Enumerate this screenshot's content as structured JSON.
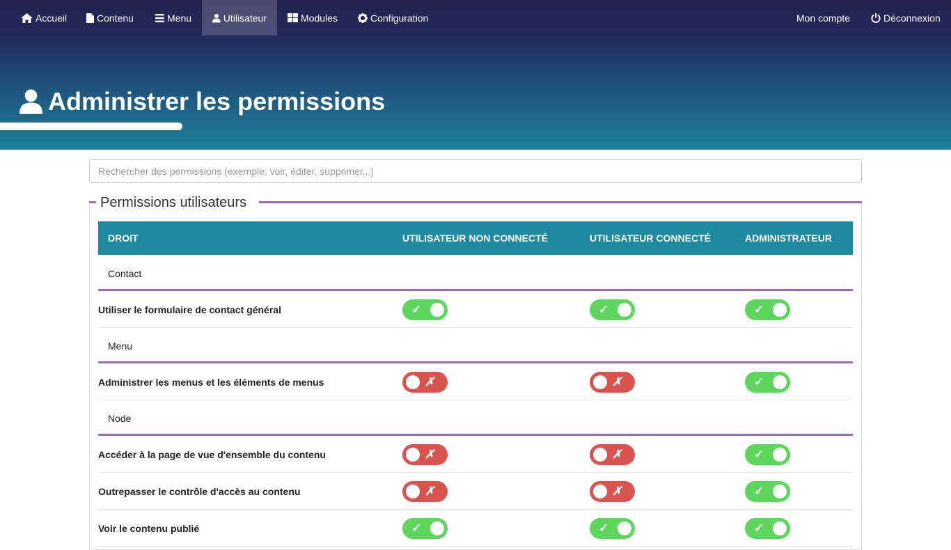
{
  "nav": {
    "left": [
      {
        "label": "Accueil",
        "icon": "home-icon"
      },
      {
        "label": "Contenu",
        "icon": "file-icon"
      },
      {
        "label": "Menu",
        "icon": "bars-icon"
      },
      {
        "label": "Utilisateur",
        "icon": "user-icon",
        "active": true
      },
      {
        "label": "Modules",
        "icon": "grid-icon"
      },
      {
        "label": "Configuration",
        "icon": "gear-icon"
      }
    ],
    "right": [
      {
        "label": "Mon compte"
      },
      {
        "label": "Déconnexion",
        "icon": "power-icon"
      }
    ]
  },
  "page": {
    "title": "Administrer les permissions",
    "title_icon": "user-icon"
  },
  "search": {
    "placeholder": "Rechercher des permissions (exemple: voir, éditer, supprimer...)",
    "value": ""
  },
  "fieldset": {
    "legend": "Permissions utilisateurs"
  },
  "table": {
    "headers": [
      "DROIT",
      "UTILISATEUR NON CONNECTÉ",
      "UTILISATEUR CONNECTÉ",
      "ADMINISTRATEUR"
    ],
    "rows": [
      {
        "type": "group",
        "label": "Contact"
      },
      {
        "type": "perm",
        "label": "Utiliser le formulaire de contact général",
        "values": [
          true,
          true,
          true
        ]
      },
      {
        "type": "group",
        "label": "Menu"
      },
      {
        "type": "perm",
        "label": "Administrer les menus et les éléments de menus",
        "values": [
          false,
          false,
          true
        ]
      },
      {
        "type": "group",
        "label": "Node"
      },
      {
        "type": "perm",
        "label": "Accéder à la page de vue d'ensemble du contenu",
        "values": [
          false,
          false,
          true
        ]
      },
      {
        "type": "perm",
        "label": "Outrepasser le contrôle d'accès au contenu",
        "values": [
          false,
          false,
          true
        ]
      },
      {
        "type": "perm",
        "label": "Voir le contenu publié",
        "values": [
          true,
          true,
          true
        ]
      }
    ]
  },
  "toggle": {
    "on_symbol": "✓",
    "off_symbol": "✗"
  },
  "colors": {
    "nav_top": "#232350",
    "hero_bottom": "#1d8199",
    "table_header": "#1e8aa0",
    "group_border": "#9b6db0",
    "toggle_on": "#5cd65c",
    "toggle_off": "#d9534f"
  }
}
